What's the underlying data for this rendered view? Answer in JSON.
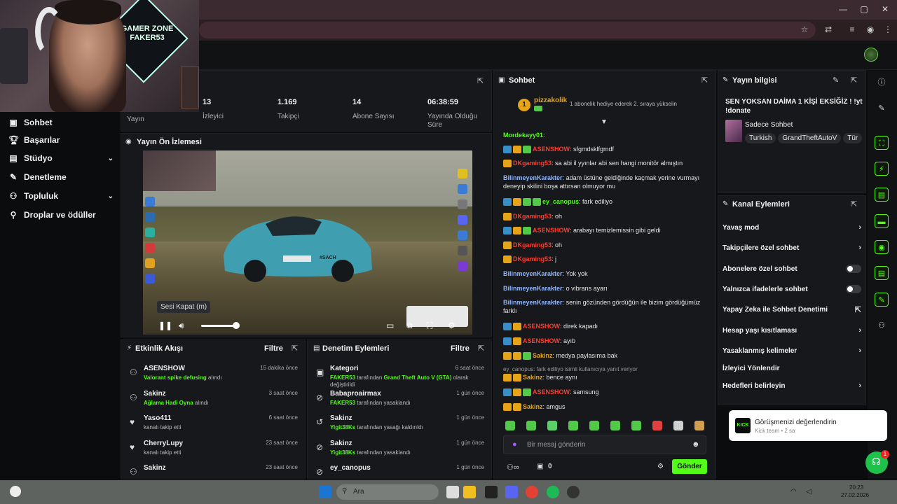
{
  "browser": {
    "window_controls": [
      "—",
      "▢",
      "✕"
    ]
  },
  "webcam": {
    "sign_text": "GAMER ZONE FAKER53"
  },
  "left_nav": {
    "items": [
      {
        "label": "Sohbet",
        "icon": "chat-icon"
      },
      {
        "label": "Başarılar",
        "icon": "trophy-icon"
      },
      {
        "label": "Stüdyo",
        "icon": "studio-icon",
        "chevron": "⌄"
      },
      {
        "label": "Denetleme",
        "icon": "wrench-icon"
      },
      {
        "label": "Topluluk",
        "icon": "community-icon",
        "chevron": "⌄"
      },
      {
        "label": "Droplar ve ödüller",
        "icon": "gift-icon"
      }
    ],
    "stream_label": "Yayın"
  },
  "stats": [
    {
      "value": "13",
      "label": "İzleyici"
    },
    {
      "value": "1.169",
      "label": "Takipçi"
    },
    {
      "value": "14",
      "label": "Abone Sayısı"
    },
    {
      "value": "06:38:59",
      "label": "Yayında Olduğu Süre"
    }
  ],
  "preview": {
    "title": "Yayın Ön İzlemesi",
    "tooltip": "Sesi Kapat (m)",
    "plate": "#SACH",
    "volume_fraction": 1.0
  },
  "activity": {
    "title": "Etkinlik Akışı",
    "filter": "Filtre",
    "items": [
      {
        "name": "ASENSHOW",
        "time": "15 dakika önce",
        "highlight": "Valorant spike defusing",
        "rest": " alındı"
      },
      {
        "name": "Sakinz",
        "time": "3 saat önce",
        "highlight": "Ağlama Hadi Oyna",
        "rest": " alındı"
      },
      {
        "name": "Yaso411",
        "time": "6 saat önce",
        "highlight": "",
        "rest": "kanalı takip etti"
      },
      {
        "name": "CherryLupy",
        "time": "23 saat önce",
        "highlight": "",
        "rest": "kanalı takip etti"
      },
      {
        "name": "Sakinz",
        "time": "23 saat önce",
        "highlight": "",
        "rest": ""
      }
    ]
  },
  "moderation": {
    "title": "Denetim Eylemleri",
    "filter": "Filtre",
    "items": [
      {
        "name": "Kategori",
        "time": "6 saat önce",
        "actor": "FAKER53",
        "mid": " tarafından ",
        "target": "Grand Theft Auto V (GTA)",
        "rest": " olarak değiştirildi"
      },
      {
        "name": "Babaproairmax",
        "time": "1 gün önce",
        "actor": "FAKER53",
        "mid": " tarafından yasaklandı",
        "target": "",
        "rest": ""
      },
      {
        "name": "Sakinz",
        "time": "1 gün önce",
        "actor": "Yigit38Ks",
        "mid": " tarafından yasağı kaldırıldı",
        "target": "",
        "rest": ""
      },
      {
        "name": "Sakinz",
        "time": "1 gün önce",
        "actor": "Yigit38Ks",
        "mid": " tarafından yasaklandı",
        "target": "",
        "rest": ""
      },
      {
        "name": "ey_canopus",
        "time": "1 gün önce",
        "actor": "",
        "mid": "",
        "target": "",
        "rest": ""
      }
    ]
  },
  "chat": {
    "title": "Sohbet",
    "pinned_user": "pizzakolik",
    "pinned_rank": "1",
    "pinned_note": "1 abonelik hediye ederek 2. sıraya yükselin",
    "messages": [
      {
        "user": "Mordekayy01",
        "cls": "u-green",
        "badges": [],
        "text": ""
      },
      {
        "user": "ASENSHOW",
        "cls": "u-red",
        "badges": [
          "b-blue",
          "b-gold",
          "b-green"
        ],
        "text": "sfgmdsklfgmdf"
      },
      {
        "user": "DKgaming53",
        "cls": "u-red",
        "badges": [
          "b-gold"
        ],
        "text": "sa abi il yyınlar abi sen hangi monitör almıştın"
      },
      {
        "user": "BilinmeyenKarakter",
        "cls": "u-blue",
        "badges": [],
        "text": "adam üstüne geldiğinde kaçmak yerine vurmayı deneyip skilini boşa attırsan olmuyor mu"
      },
      {
        "user": "ey_canopus",
        "cls": "u-green",
        "badges": [
          "b-blue",
          "b-gold",
          "b-green",
          "b-green"
        ],
        "text": "fark ediliyo"
      },
      {
        "user": "DKgaming53",
        "cls": "u-red",
        "badges": [
          "b-gold"
        ],
        "text": "oh"
      },
      {
        "user": "ASENSHOW",
        "cls": "u-red",
        "badges": [
          "b-blue",
          "b-gold",
          "b-green"
        ],
        "text": "arabayı temizlemissin gibi geldi"
      },
      {
        "user": "DKgaming53",
        "cls": "u-red",
        "badges": [
          "b-gold"
        ],
        "text": "oh"
      },
      {
        "user": "DKgaming53",
        "cls": "u-red",
        "badges": [
          "b-gold"
        ],
        "text": "j"
      },
      {
        "user": "BilinmeyenKarakter",
        "cls": "u-blue",
        "badges": [],
        "text": "Yok yok"
      },
      {
        "user": "BilinmeyenKarakter",
        "cls": "u-blue",
        "badges": [],
        "text": "o vibrans ayarı"
      },
      {
        "user": "BilinmeyenKarakter",
        "cls": "u-blue",
        "badges": [],
        "text": "senin gözünden gördüğün ile bizim gördüğümüz farklı"
      },
      {
        "user": "ASENSHOW",
        "cls": "u-red",
        "badges": [
          "b-blue",
          "b-gold"
        ],
        "text": "direk kapadı"
      },
      {
        "user": "ASENSHOW",
        "cls": "u-red",
        "badges": [
          "b-blue",
          "b-gold"
        ],
        "text": "ayıb"
      },
      {
        "user": "Sakinz",
        "cls": "u-gold",
        "badges": [
          "b-gold",
          "b-gold",
          "b-green"
        ],
        "text": "medya paylasıma bak"
      },
      {
        "user": "Sakinz",
        "cls": "u-gold",
        "badges": [
          "b-gold",
          "b-gold"
        ],
        "text": "bence aynı"
      },
      {
        "user": "ASENSHOW",
        "cls": "u-red",
        "badges": [
          "b-blue",
          "b-gold",
          "b-green"
        ],
        "text": "samsung"
      },
      {
        "user": "Sakinz",
        "cls": "u-gold",
        "badges": [
          "b-gold",
          "b-gold"
        ],
        "text": "amgus"
      }
    ],
    "reply_note": "ey_canopus: fark ediliyo isimli kullanıcıya yanıt veriyor",
    "input_placeholder": "Bir mesaj gönderin",
    "send_label": "Gönder",
    "points": "0"
  },
  "stream_info": {
    "title": "Yayın bilgisi",
    "stream_title": "SEN YOKSAN DAİMA 1 KİŞİ EKSİĞİZ ! !yt !donate",
    "category": "Sadece Sohbet",
    "tags": [
      "Turkish",
      "GrandTheftAutoV",
      "Tür"
    ]
  },
  "channel_actions": {
    "title": "Kanal Eylemleri",
    "items": [
      {
        "label": "Yavaş mod",
        "type": "chevron"
      },
      {
        "label": "Takipçilere özel sohbet",
        "type": "chevron"
      },
      {
        "label": "Abonelere özel sohbet",
        "type": "toggle"
      },
      {
        "label": "Yalnızca ifadelerle sohbet",
        "type": "toggle"
      },
      {
        "label": "Yapay Zeka ile Sohbet Denetimi",
        "type": "link"
      },
      {
        "label": "Hesap yaşı kısıtlaması",
        "type": "chevron"
      },
      {
        "label": "Yasaklanmış kelimeler",
        "type": "chevron"
      },
      {
        "label": "İzleyici Yönlendir",
        "type": "none"
      },
      {
        "label": "Hedefleri belirleyin",
        "type": "chevron"
      }
    ]
  },
  "toast": {
    "logo": "KICK",
    "title": "Görüşmenizi değerlendirin",
    "sub": "Kick team • 2 sa",
    "help_count": "1"
  },
  "taskbar": {
    "search_placeholder": "Ara",
    "clock_time": "20:23",
    "clock_date": "27.02.2026"
  }
}
